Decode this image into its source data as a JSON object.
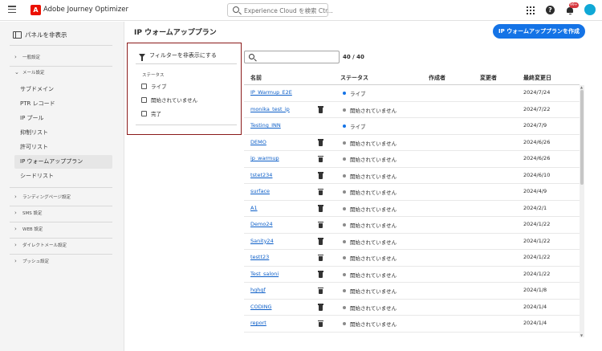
{
  "app": {
    "title": "Adobe Journey Optimizer",
    "logo_letter": "A",
    "search_placeholder": "Experience Cloud を検索 Ctr...",
    "notification_count": "99+",
    "help_glyph": "?"
  },
  "sidebar": {
    "hide_panel_label": "パネルを非表示",
    "sections": [
      {
        "label": "一般設定",
        "expanded": false
      },
      {
        "label": "メール設定",
        "expanded": true
      },
      {
        "label": "ランディングページ設定",
        "expanded": false
      },
      {
        "label": "SMS 設定",
        "expanded": false
      },
      {
        "label": "WEB 設定",
        "expanded": false
      },
      {
        "label": "ダイレクトメール設定",
        "expanded": false
      },
      {
        "label": "プッシュ設定",
        "expanded": false
      }
    ],
    "email_items": [
      {
        "label": "サブドメイン",
        "active": false
      },
      {
        "label": "PTR レコード",
        "active": false
      },
      {
        "label": "IP プール",
        "active": false
      },
      {
        "label": "抑制リスト",
        "active": false
      },
      {
        "label": "許可リスト",
        "active": false
      },
      {
        "label": "IP ウォームアッププラン",
        "active": true
      },
      {
        "label": "シードリスト",
        "active": false
      }
    ]
  },
  "page": {
    "title": "IP ウォームアッププラン",
    "create_button_label": "IP ウォームアッププランを作成",
    "result_count": "40 / 40"
  },
  "filter": {
    "toggle_label": "フィルターを非表示にする",
    "status_heading": "ステータス",
    "options": [
      {
        "label": "ライブ",
        "checked": false
      },
      {
        "label": "開始されていません",
        "checked": false
      },
      {
        "label": "完了",
        "checked": false
      }
    ]
  },
  "table": {
    "columns": {
      "name": "名前",
      "status": "ステータス",
      "created_by": "作成者",
      "modified_by": "変更者",
      "last_modified": "最終変更日"
    },
    "status_colors": {
      "live": "#1473e6",
      "not_started": "#8a8a8a"
    },
    "rows": [
      {
        "name": "IP_Warmup_E2E",
        "deletable": false,
        "status": "ライブ",
        "status_key": "live",
        "date": "2024/7/24"
      },
      {
        "name": "monika_test_ip",
        "deletable": true,
        "status": "開始されていません",
        "status_key": "not_started",
        "date": "2024/7/22"
      },
      {
        "name": "Testing_INN",
        "deletable": false,
        "status": "ライブ",
        "status_key": "live",
        "date": "2024/7/9"
      },
      {
        "name": "DEMO",
        "deletable": true,
        "status": "開始されていません",
        "status_key": "not_started",
        "date": "2024/6/26"
      },
      {
        "name": "ip_warmup",
        "deletable": true,
        "status": "開始されていません",
        "status_key": "not_started",
        "date": "2024/6/26"
      },
      {
        "name": "tstet234",
        "deletable": true,
        "status": "開始されていません",
        "status_key": "not_started",
        "date": "2024/6/10"
      },
      {
        "name": "surface",
        "deletable": true,
        "status": "開始されていません",
        "status_key": "not_started",
        "date": "2024/4/9"
      },
      {
        "name": "A1",
        "deletable": true,
        "status": "開始されていません",
        "status_key": "not_started",
        "date": "2024/2/1"
      },
      {
        "name": "Demo24",
        "deletable": true,
        "status": "開始されていません",
        "status_key": "not_started",
        "date": "2024/1/22"
      },
      {
        "name": "Sanity24",
        "deletable": true,
        "status": "開始されていません",
        "status_key": "not_started",
        "date": "2024/1/22"
      },
      {
        "name": "testt23",
        "deletable": true,
        "status": "開始されていません",
        "status_key": "not_started",
        "date": "2024/1/22"
      },
      {
        "name": "Test_saloni",
        "deletable": true,
        "status": "開始されていません",
        "status_key": "not_started",
        "date": "2024/1/22"
      },
      {
        "name": "hghgf",
        "deletable": true,
        "status": "開始されていません",
        "status_key": "not_started",
        "date": "2024/1/8"
      },
      {
        "name": "CODING",
        "deletable": true,
        "status": "開始されていません",
        "status_key": "not_started",
        "date": "2024/1/4"
      },
      {
        "name": "report",
        "deletable": true,
        "status": "開始されていません",
        "status_key": "not_started",
        "date": "2024/1/4"
      }
    ]
  }
}
